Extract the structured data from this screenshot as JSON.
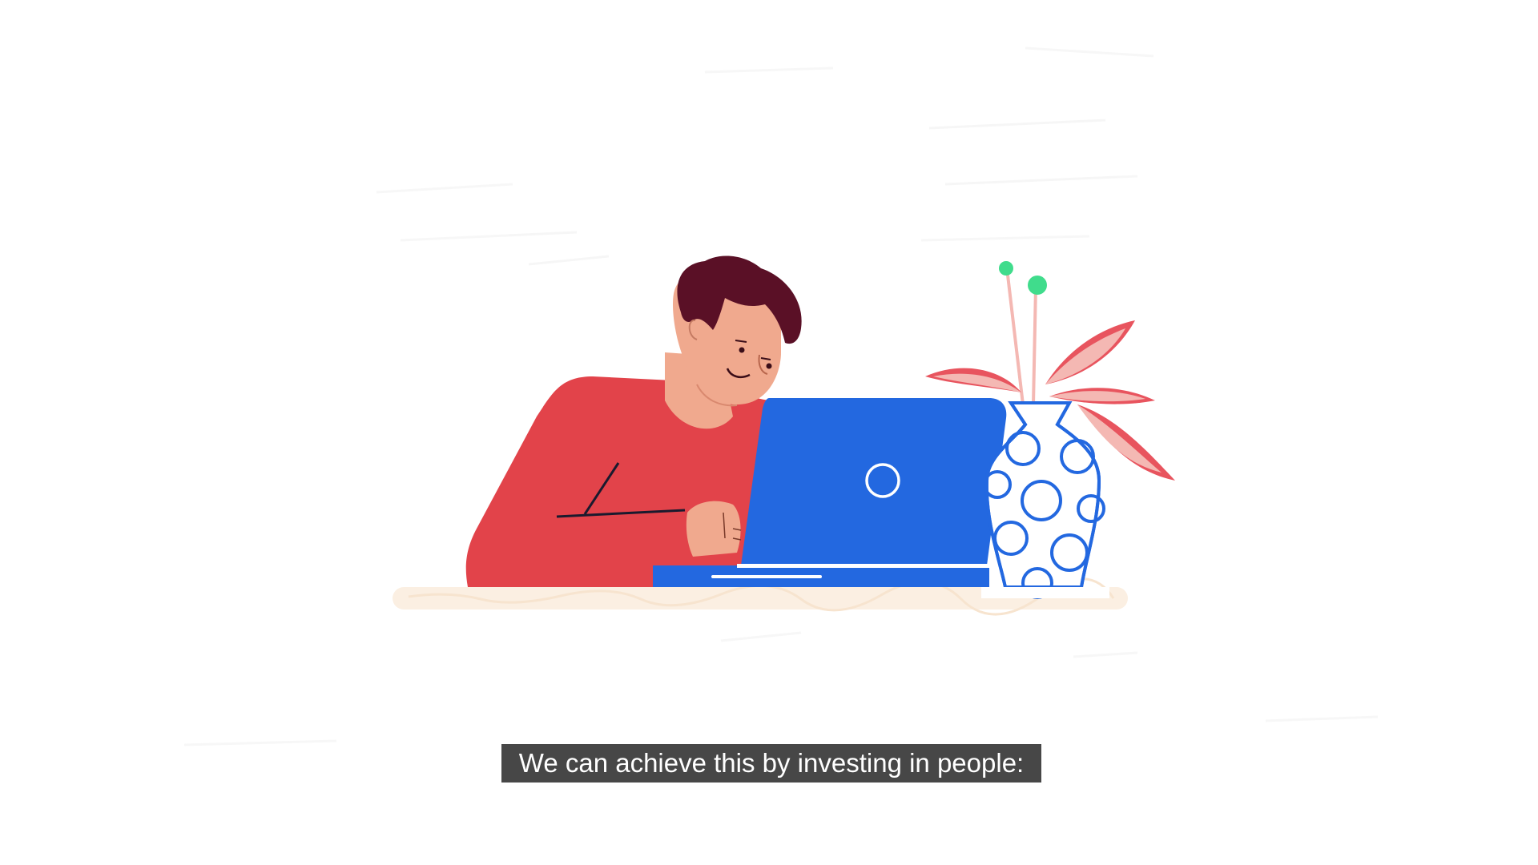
{
  "video": {
    "caption": "We can achieve this by investing in people:"
  },
  "scene": {
    "subject": "person-working-on-laptop",
    "objects": [
      "person",
      "laptop",
      "flower-vase",
      "desk"
    ],
    "colors": {
      "background": "#ffffff",
      "sweater": "#e2434a",
      "skin": "#f0a98e",
      "hair": "#5a1026",
      "laptop": "#2368e0",
      "vase_outline": "#2368e0",
      "leaves": "#e8545e",
      "leaves_light": "#f4b8b3",
      "buds": "#40dc8c",
      "desk": "#fbefe2",
      "caption_bg": "#3c3c3c",
      "caption_text": "#ffffff"
    }
  }
}
